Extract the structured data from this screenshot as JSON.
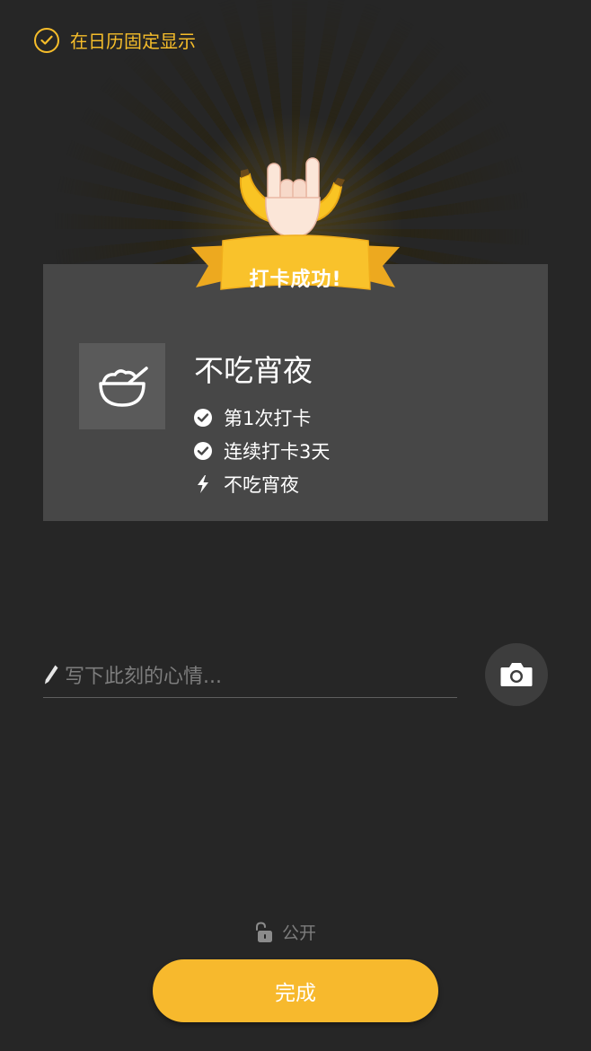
{
  "pin": {
    "label": "在日历固定显示",
    "checked": true,
    "icon": "check-circle-icon"
  },
  "badge": {
    "text": "打卡成功!",
    "icons": [
      "banana-icon",
      "rock-hand-icon",
      "ribbon-banner"
    ]
  },
  "habit": {
    "title": "不吃宵夜",
    "icon": "bowl-icon",
    "stats": [
      {
        "icon": "check-circle-icon",
        "text": "第1次打卡"
      },
      {
        "icon": "check-circle-icon",
        "text": "连续打卡3天"
      },
      {
        "icon": "lightning-icon",
        "text": "不吃宵夜"
      }
    ]
  },
  "mood": {
    "placeholder": "写下此刻的心情...",
    "value": "",
    "icon": "pencil-icon"
  },
  "camera": {
    "icon": "camera-icon"
  },
  "privacy": {
    "label": "公开",
    "icon": "unlock-icon"
  },
  "done_button": {
    "label": "完成"
  },
  "colors": {
    "accent": "#F7B92D",
    "background": "#262626",
    "card": "#474747"
  }
}
